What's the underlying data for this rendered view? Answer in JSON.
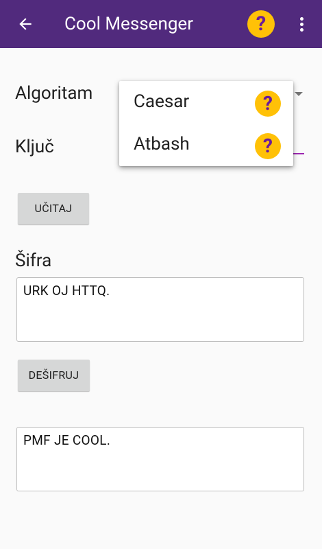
{
  "app_bar": {
    "title": "Cool Messenger",
    "back_icon": "arrow-left-icon",
    "help_icon": "question-mark-icon",
    "help_glyph": "?",
    "overflow_icon": "more-vert-icon",
    "background_color": "#512a7d",
    "help_color": "#ffc107"
  },
  "form": {
    "algorithm_label": "Algoritam",
    "key_label": "Ključ",
    "load_button": "UČITAJ",
    "cipher_label": "Šifra",
    "cipher_text": "URK OJ HTTQ.",
    "decrypt_button": "DEŠIFRUJ",
    "result_text": "PMF JE COOL."
  },
  "dropdown": {
    "items": [
      {
        "label": "Caesar",
        "help_glyph": "?"
      },
      {
        "label": "Atbash",
        "help_glyph": "?"
      }
    ]
  }
}
